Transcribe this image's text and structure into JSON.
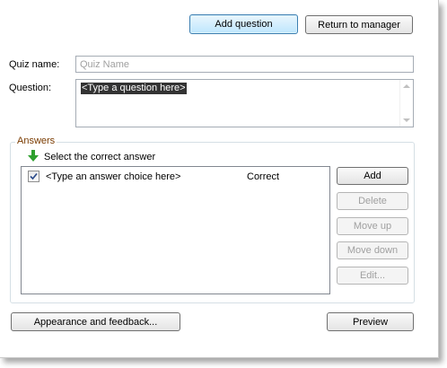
{
  "header": {
    "add_question_label": "Add question",
    "return_label": "Return to manager"
  },
  "form": {
    "quiz_name_label": "Quiz name:",
    "quiz_name_value": "",
    "quiz_name_placeholder": "Quiz Name",
    "question_label": "Question:",
    "question_value": "<Type a question here>"
  },
  "answers": {
    "group_title": "Answers",
    "hint": "Select the correct answer",
    "items": [
      {
        "text": "<Type an answer choice here>",
        "status": "Correct",
        "checked": true
      }
    ],
    "buttons": {
      "add": "Add",
      "delete": "Delete",
      "move_up": "Move up",
      "move_down": "Move down",
      "edit": "Edit..."
    }
  },
  "footer": {
    "appearance_label": "Appearance and feedback...",
    "preview_label": "Preview"
  },
  "icons": {
    "hint_arrow": "green-down-arrow-icon",
    "checkbox": "checkmark-icon"
  },
  "colors": {
    "group_title": "#7a3b00",
    "hint_arrow": "#2ea02e",
    "primary_button_border": "#3c7fb1"
  }
}
